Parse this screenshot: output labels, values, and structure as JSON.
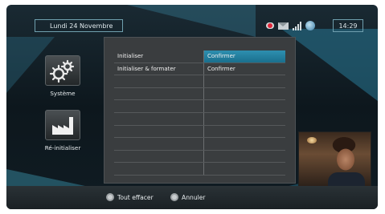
{
  "header": {
    "date": "Lundi 24 Novembre",
    "time": "14:29",
    "status_icons": [
      "record-icon",
      "mail-icon",
      "signal-icon",
      "network-globe-icon"
    ]
  },
  "sidebar": {
    "items": [
      {
        "label": "Système",
        "icon": "gears-icon"
      },
      {
        "label": "Ré-initialiser",
        "icon": "factory-icon"
      }
    ]
  },
  "menu": {
    "rows": [
      {
        "option": "Initialiser",
        "action": "Confirmer"
      },
      {
        "option": "Initialiser & formater",
        "action": "Confirmer"
      },
      {
        "option": "",
        "action": ""
      },
      {
        "option": "",
        "action": ""
      },
      {
        "option": "",
        "action": ""
      },
      {
        "option": "",
        "action": ""
      },
      {
        "option": "",
        "action": ""
      },
      {
        "option": "",
        "action": ""
      },
      {
        "option": "",
        "action": ""
      },
      {
        "option": "",
        "action": ""
      }
    ],
    "selected_index": 0
  },
  "footer": {
    "clear_all_label": "Tout effacer",
    "cancel_label": "Annuler"
  },
  "colors": {
    "accent": "#1f7fa0",
    "record": "#e0263a"
  }
}
